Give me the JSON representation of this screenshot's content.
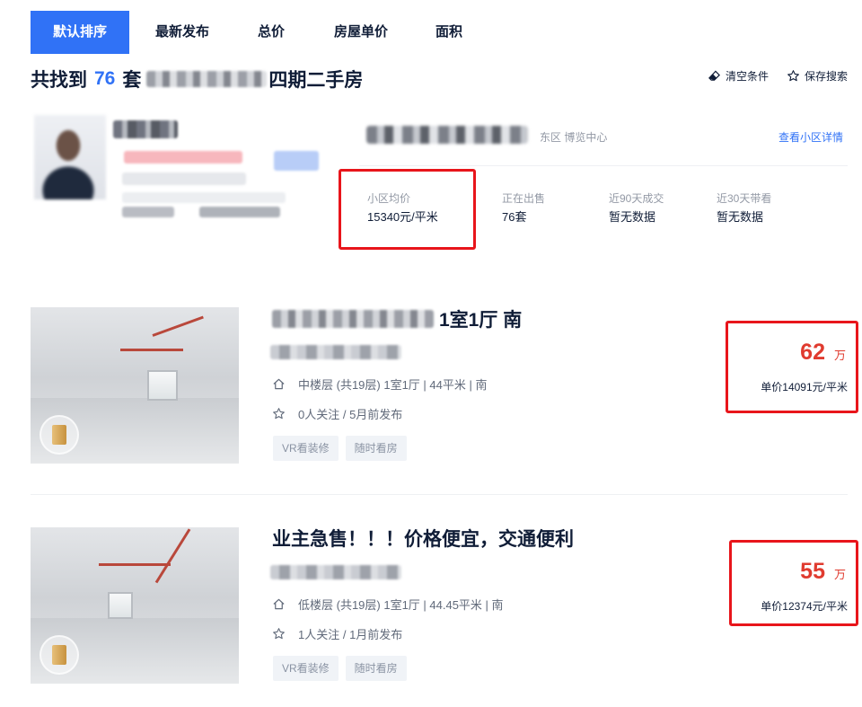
{
  "sort_tabs": [
    {
      "label": "默认排序",
      "active": true
    },
    {
      "label": "最新发布",
      "active": false
    },
    {
      "label": "总价",
      "active": false
    },
    {
      "label": "房屋单价",
      "active": false
    },
    {
      "label": "面积",
      "active": false
    }
  ],
  "result": {
    "prefix": "共找到",
    "count": "76",
    "measure": "套",
    "suffix": "四期二手房"
  },
  "actions": {
    "clear": "清空条件",
    "save": "保存搜索"
  },
  "community": {
    "district": "东区 博览中心",
    "detail_link": "查看小区详情",
    "stats": [
      {
        "label": "小区均价",
        "value": "15340元/平米"
      },
      {
        "label": "正在出售",
        "value": "76套"
      },
      {
        "label": "近90天成交",
        "value": "暂无数据"
      },
      {
        "label": "近30天带看",
        "value": "暂无数据"
      }
    ]
  },
  "listings": [
    {
      "title": "1室1厅 南",
      "info": "中楼层 (共19层) 1室1厅 | 44平米 | 南",
      "follow": "0人关注 / 5月前发布",
      "tags": [
        "VR看装修",
        "随时看房"
      ],
      "total_price": "62",
      "total_unit": "万",
      "unit_price": "单价14091元/平米"
    },
    {
      "title": "业主急售！！！价格便宜，交通便利",
      "info": "低楼层 (共19层) 1室1厅 | 44.45平米 | 南",
      "follow": "1人关注 / 1月前发布",
      "tags": [
        "VR看装修",
        "随时看房"
      ],
      "total_price": "55",
      "total_unit": "万",
      "unit_price": "单价12374元/平米"
    }
  ],
  "colors": {
    "accent": "#3072f6",
    "price_red": "#e03b2f",
    "highlight_box": "#e8151b"
  }
}
